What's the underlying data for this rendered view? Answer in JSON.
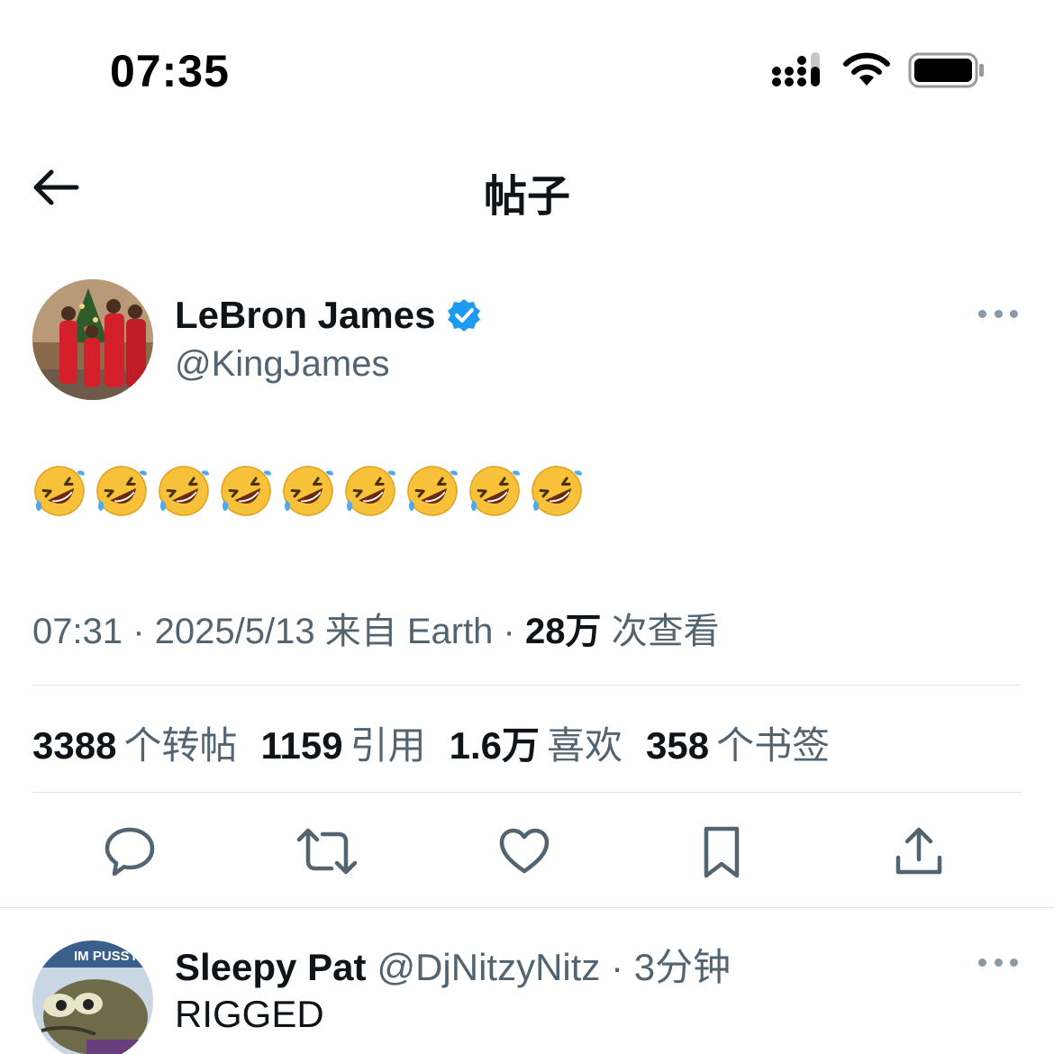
{
  "status_bar": {
    "time": "07:35"
  },
  "nav": {
    "title": "帖子"
  },
  "tweet": {
    "author_name": "LeBron James",
    "author_handle": "@KingJames",
    "verified": true,
    "emoji_name": "rolling-on-the-floor-laughing",
    "emoji_count": 9,
    "meta_prefix": "07:31 · 2025/5/13 来自 Earth · ",
    "views_count": "28万",
    "views_label": " 次查看",
    "stats": [
      {
        "count": "3388",
        "label": "个转帖"
      },
      {
        "count": "1159",
        "label": "引用"
      },
      {
        "count": "1.6万",
        "label": "喜欢"
      },
      {
        "count": "358",
        "label": "个书签"
      }
    ],
    "actions": [
      "reply-icon",
      "retweet-icon",
      "like-icon",
      "bookmark-icon",
      "share-icon"
    ]
  },
  "reply": {
    "name": "Sleepy Pat",
    "handle": "@DjNitzyNitz · 3分钟",
    "text": "RIGGED",
    "avatar_text": "IM PUSSY"
  },
  "colors": {
    "primary_text": "#0f1419",
    "secondary_text": "#536471",
    "verified_blue": "#1d9bf0",
    "divider": "#dfe3e6"
  }
}
